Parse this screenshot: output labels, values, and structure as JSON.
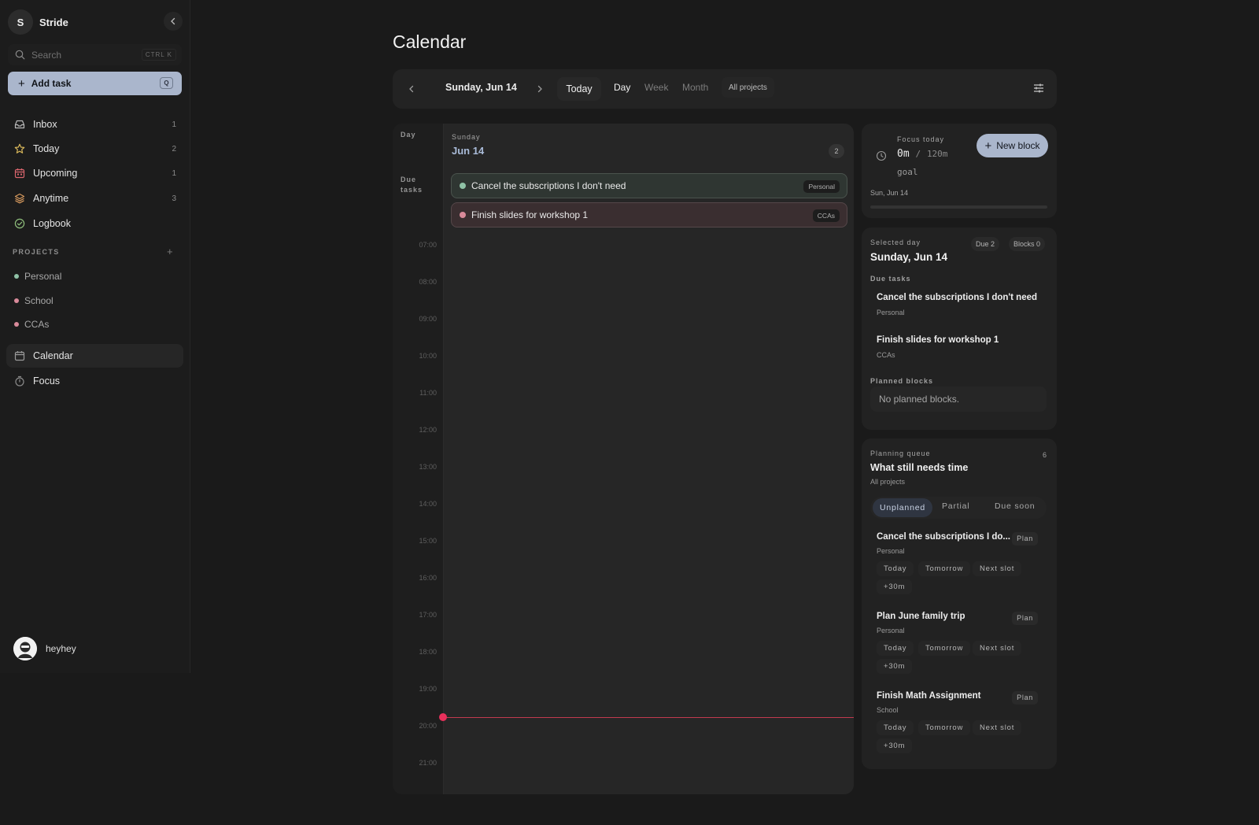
{
  "workspace": {
    "initial": "S",
    "name": "Stride"
  },
  "search": {
    "placeholder": "Search",
    "shortcut": "CTRL K"
  },
  "add_task": {
    "label": "Add task",
    "shortcut": "Q"
  },
  "nav": [
    {
      "label": "Inbox",
      "count": "1",
      "icon": "inbox-icon",
      "color": "#b8b8b8"
    },
    {
      "label": "Today",
      "count": "2",
      "icon": "star-icon",
      "color": "#d8b75a"
    },
    {
      "label": "Upcoming",
      "count": "1",
      "icon": "calendar-icon",
      "color": "#d9656d"
    },
    {
      "label": "Anytime",
      "count": "3",
      "icon": "layers-icon",
      "color": "#d79a5e"
    },
    {
      "label": "Logbook",
      "count": "",
      "icon": "check-circle-icon",
      "color": "#8fbf7c"
    }
  ],
  "projects": {
    "title": "PROJECTS",
    "items": [
      {
        "label": "Personal",
        "color": "#8fc2a6"
      },
      {
        "label": "School",
        "color": "#d98a9a"
      },
      {
        "label": "CCAs",
        "color": "#d98a9a"
      }
    ]
  },
  "nav2": [
    {
      "label": "Calendar",
      "icon": "calendar-icon",
      "active": true
    },
    {
      "label": "Focus",
      "icon": "stopwatch-icon",
      "active": false
    }
  ],
  "user": {
    "name": "heyhey"
  },
  "page": {
    "title": "Calendar"
  },
  "toolbar": {
    "date": "Sunday, Jun 14",
    "today": "Today",
    "views": [
      "Day",
      "Week",
      "Month"
    ],
    "selected_view": "Day",
    "projects_filter": "All projects"
  },
  "grid": {
    "day_label": "Day",
    "due_label_1": "Due",
    "due_label_2": "tasks",
    "day_name": "Sunday",
    "day_date": "Jun 14",
    "due_count": "2",
    "hours": [
      "07:00",
      "08:00",
      "09:00",
      "10:00",
      "11:00",
      "12:00",
      "13:00",
      "14:00",
      "15:00",
      "16:00",
      "17:00",
      "18:00",
      "19:00",
      "20:00",
      "21:00"
    ],
    "tasks": [
      {
        "title": "Cancel the subscriptions I don't need",
        "tag": "Personal",
        "color": "#8fc2a6"
      },
      {
        "title": "Finish slides for workshop 1",
        "tag": "CCAs",
        "color": "#d98a9a"
      }
    ]
  },
  "focus": {
    "title": "Focus today",
    "value": "0m",
    "separator": "/",
    "target": "120m",
    "goal": "goal",
    "date": "Sun, Jun 14",
    "progress": 0,
    "new_block": "New block"
  },
  "selected_day": {
    "title": "Selected day",
    "due_badge": "Due 2",
    "blocks_badge": "Blocks 0",
    "date": "Sunday, Jun 14",
    "due_title": "Due tasks",
    "due_tasks": [
      {
        "title": "Cancel the subscriptions I don't need",
        "project": "Personal"
      },
      {
        "title": "Finish slides for workshop 1",
        "project": "CCAs"
      }
    ],
    "planned_title": "Planned blocks",
    "planned_empty": "No planned blocks."
  },
  "queue": {
    "title": "Planning queue",
    "heading": "What still needs time",
    "sub": "All projects",
    "count": "6",
    "tabs": [
      "Unplanned",
      "Partial",
      "Due soon"
    ],
    "selected_tab": "Unplanned",
    "plan_label": "Plan",
    "chips": [
      "Today",
      "Tomorrow",
      "Next slot",
      "+30m"
    ],
    "items": [
      {
        "title": "Cancel the subscriptions I do...",
        "project": "Personal"
      },
      {
        "title": "Plan June family trip",
        "project": "Personal"
      },
      {
        "title": "Finish Math Assignment",
        "project": "School"
      }
    ]
  },
  "colors": {
    "accent": "#aab6cc",
    "now_line": "#e8305b"
  }
}
